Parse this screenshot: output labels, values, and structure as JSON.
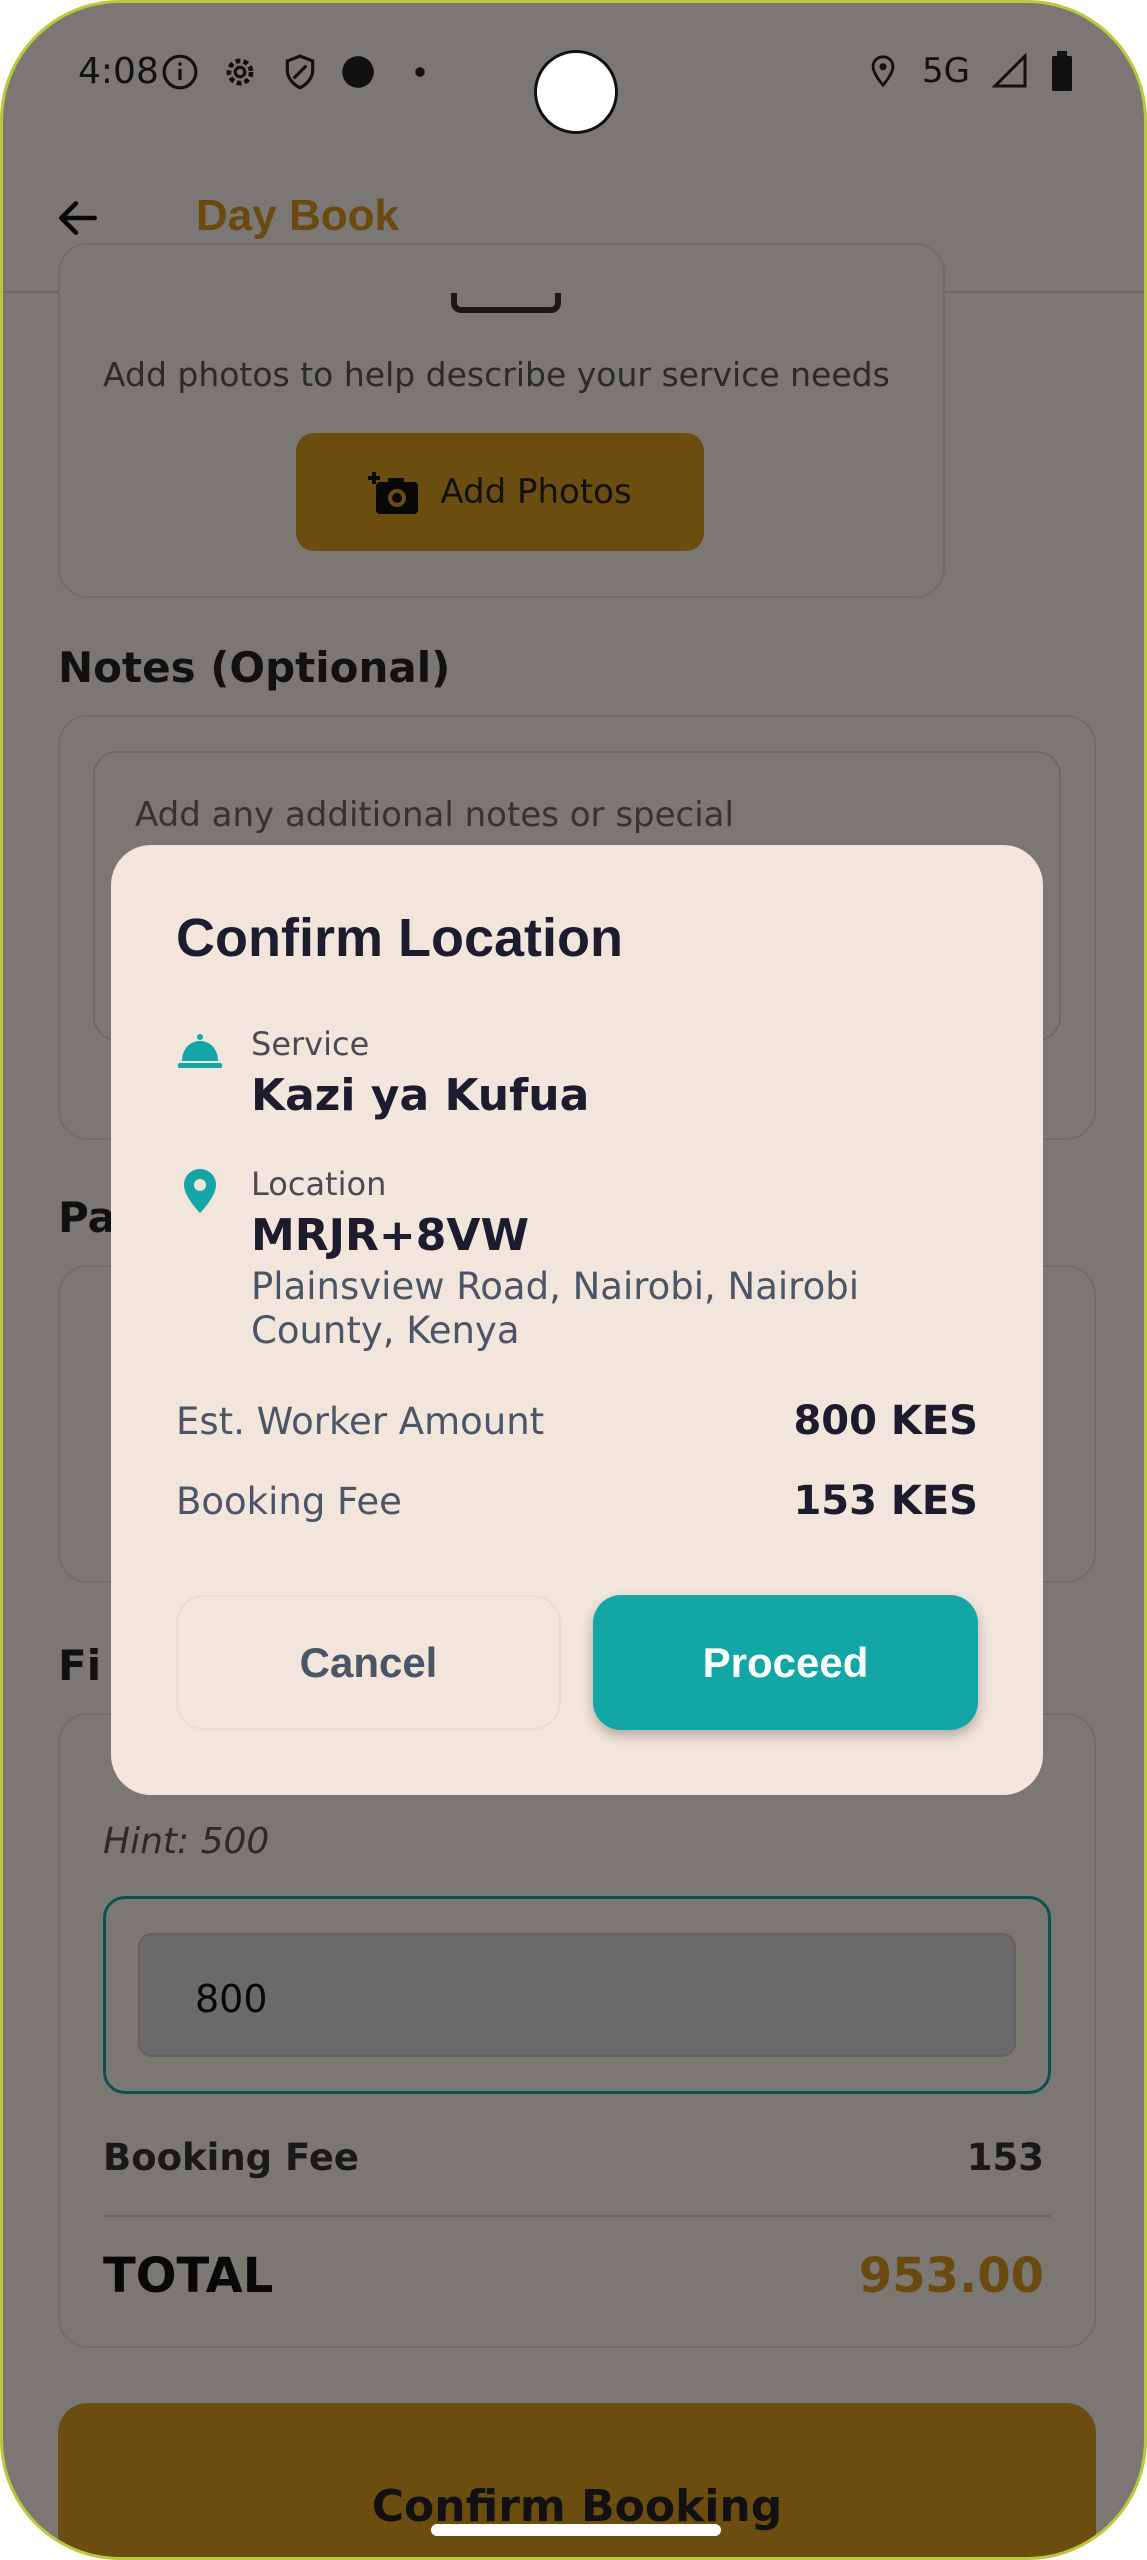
{
  "status_bar": {
    "time": "4:08",
    "network": "5G",
    "icons": [
      "info-icon",
      "gear-icon",
      "shield-icon",
      "circle-icon",
      "dot-icon",
      "location-icon",
      "signal-icon",
      "battery-icon"
    ]
  },
  "app_bar": {
    "title": "Day Book",
    "title_color": "#d4941d",
    "back_icon": "arrow-left-icon"
  },
  "photos": {
    "description": "Add photos to help describe your service needs",
    "button_label": "Add Photos"
  },
  "notes": {
    "section_label": "Notes (Optional)",
    "placeholder": "Add any additional notes or special"
  },
  "payment": {
    "section_label_partial": "Pa"
  },
  "financial": {
    "section_label_partial": "Fi",
    "hint": "Hint: 500",
    "amount_value": "800",
    "booking_fee_label": "Booking Fee",
    "booking_fee_value": "153",
    "total_label": "TOTAL",
    "total_value": "953.00"
  },
  "confirm_booking_label": "Confirm Booking",
  "dialog": {
    "title": "Confirm Location",
    "service_label": "Service",
    "service_value": "Kazi ya Kufua",
    "location_label": "Location",
    "location_code": "MRJR+8VW",
    "location_address": "Plainsview Road, Nairobi, Nairobi County, Kenya",
    "est_worker_label": "Est. Worker Amount",
    "est_worker_value": "800 KES",
    "booking_fee_label": "Booking Fee",
    "booking_fee_value": "153 KES",
    "cancel_label": "Cancel",
    "proceed_label": "Proceed",
    "accent_color": "#12a6a6"
  }
}
